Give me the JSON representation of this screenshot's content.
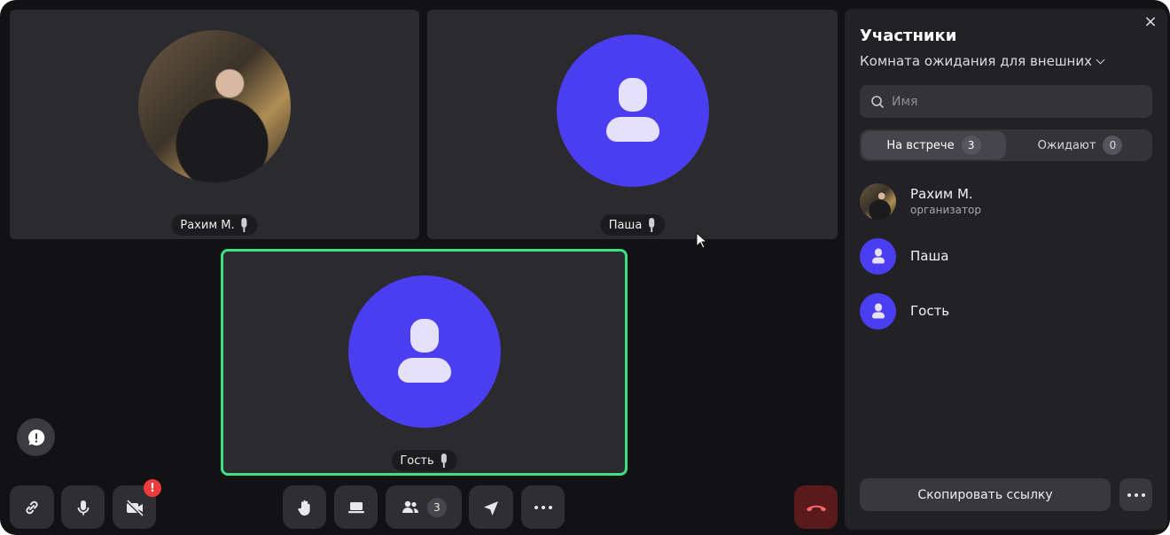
{
  "tiles": [
    {
      "name": "Рахим М."
    },
    {
      "name": "Паша"
    },
    {
      "name": "Гость"
    }
  ],
  "toolbar": {
    "participants_count": "3",
    "camera_alert": "!"
  },
  "sidebar": {
    "title": "Участники",
    "close": "×",
    "room_selector": "Комната ожидания для внешних",
    "search_placeholder": "Имя",
    "tabs": [
      {
        "label": "На встрече",
        "count": "3"
      },
      {
        "label": "Ожидают",
        "count": "0"
      }
    ],
    "participants": [
      {
        "name": "Рахим М.",
        "role": "организатор"
      },
      {
        "name": "Паша"
      },
      {
        "name": "Гость"
      }
    ],
    "copy_link_label": "Скопировать ссылку"
  },
  "colors": {
    "avatar_blue": "#4a3ef0",
    "active_speaker_border": "#3ee07f",
    "hangup": "#5a1a1c",
    "alert": "#ef3b3b"
  }
}
